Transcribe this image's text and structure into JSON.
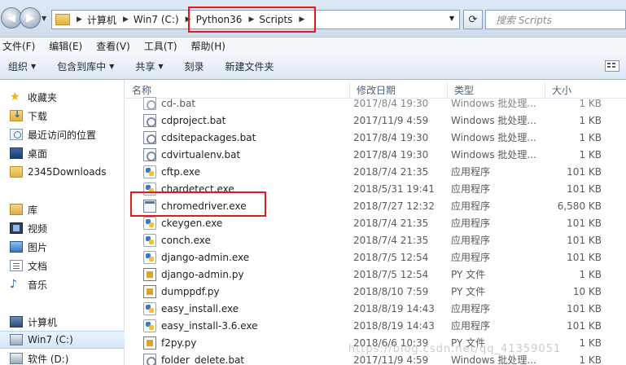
{
  "address": {
    "crumbs": [
      "计算机",
      "Win7 (C:)",
      "Python36",
      "Scripts"
    ],
    "search_placeholder": "搜索 Scripts"
  },
  "menu": [
    "文件(F)",
    "编辑(E)",
    "查看(V)",
    "工具(T)",
    "帮助(H)"
  ],
  "toolbar": {
    "organize": "组织",
    "include_in_library": "包含到库中",
    "share": "共享",
    "burn": "刻录",
    "new_folder": "新建文件夹"
  },
  "nav": {
    "favorites": "收藏夹",
    "downloads": "下载",
    "recent": "最近访问的位置",
    "desktop": "桌面",
    "downloads2345": "2345Downloads",
    "libraries": "库",
    "videos": "视频",
    "pictures": "图片",
    "documents": "文档",
    "music": "音乐",
    "computer": "计算机",
    "drive_c": "Win7 (C:)",
    "drive_d": "软件 (D:)"
  },
  "columns": {
    "name": "名称",
    "date": "修改日期",
    "type": "类型",
    "size": "大小"
  },
  "files": [
    {
      "name": "cd-.bat",
      "date": "2017/8/4 19:30",
      "type": "Windows 批处理...",
      "size": "1 KB",
      "icon": "bat-icon"
    },
    {
      "name": "cdproject.bat",
      "date": "2017/11/9 4:59",
      "type": "Windows 批处理...",
      "size": "1 KB",
      "icon": "bat-icon"
    },
    {
      "name": "cdsitepackages.bat",
      "date": "2017/8/4 19:30",
      "type": "Windows 批处理...",
      "size": "1 KB",
      "icon": "bat-icon"
    },
    {
      "name": "cdvirtualenv.bat",
      "date": "2017/8/4 19:30",
      "type": "Windows 批处理...",
      "size": "1 KB",
      "icon": "bat-icon"
    },
    {
      "name": "cftp.exe",
      "date": "2018/7/4 21:35",
      "type": "应用程序",
      "size": "101 KB",
      "icon": "exe-icon"
    },
    {
      "name": "chardetect.exe",
      "date": "2018/5/31 19:41",
      "type": "应用程序",
      "size": "101 KB",
      "icon": "exe-icon"
    },
    {
      "name": "chromedriver.exe",
      "date": "2018/7/27 12:32",
      "type": "应用程序",
      "size": "6,580 KB",
      "icon": "app-icon"
    },
    {
      "name": "ckeygen.exe",
      "date": "2018/7/4 21:35",
      "type": "应用程序",
      "size": "101 KB",
      "icon": "exe-icon"
    },
    {
      "name": "conch.exe",
      "date": "2018/7/4 21:35",
      "type": "应用程序",
      "size": "101 KB",
      "icon": "exe-icon"
    },
    {
      "name": "django-admin.exe",
      "date": "2018/7/5 12:54",
      "type": "应用程序",
      "size": "101 KB",
      "icon": "exe-icon"
    },
    {
      "name": "django-admin.py",
      "date": "2018/7/5 12:54",
      "type": "PY 文件",
      "size": "1 KB",
      "icon": "py-icon"
    },
    {
      "name": "dumppdf.py",
      "date": "2018/8/10 7:59",
      "type": "PY 文件",
      "size": "10 KB",
      "icon": "py-icon"
    },
    {
      "name": "easy_install.exe",
      "date": "2018/8/19 14:43",
      "type": "应用程序",
      "size": "101 KB",
      "icon": "exe-icon"
    },
    {
      "name": "easy_install-3.6.exe",
      "date": "2018/8/19 14:43",
      "type": "应用程序",
      "size": "101 KB",
      "icon": "exe-icon"
    },
    {
      "name": "f2py.py",
      "date": "2018/6/6 10:39",
      "type": "PY 文件",
      "size": "1 KB",
      "icon": "py-icon"
    },
    {
      "name": "folder_delete.bat",
      "date": "2017/11/9 4:59",
      "type": "Windows 批处理...",
      "size": "1 KB",
      "icon": "bat-icon"
    }
  ],
  "watermark": "https://blog.csdn.net/qq_41359051"
}
